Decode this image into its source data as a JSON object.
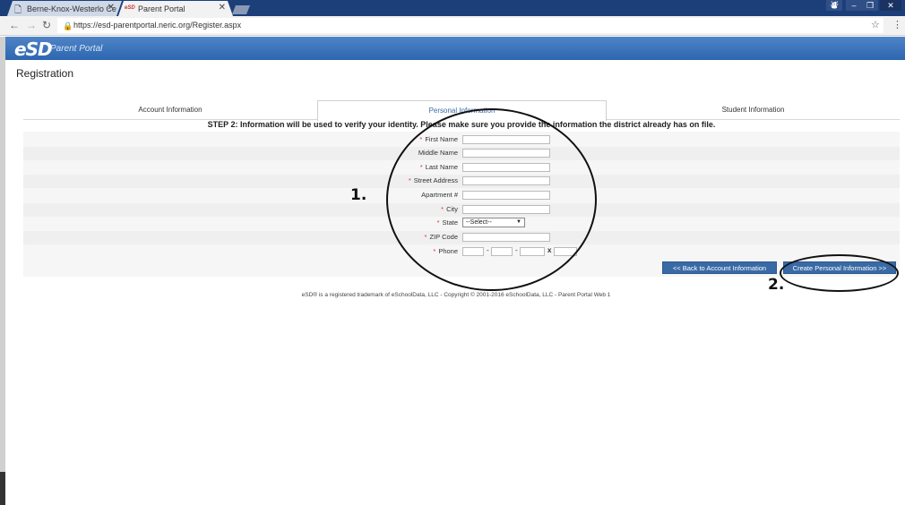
{
  "browser": {
    "tabs": [
      {
        "label": "Berne-Knox-Westerlo Ce",
        "icon": "page-icon"
      },
      {
        "label": "Parent Portal",
        "icon": "esd-favicon",
        "favicon_text": "eSD"
      }
    ],
    "url": "https://esd-parentportal.neric.org/Register.aspx"
  },
  "app": {
    "logo": "eSD",
    "logo_sub": "Parent Portal",
    "accent_color": "#2d66b0"
  },
  "page": {
    "title": "Registration",
    "tabs": [
      "Account Information",
      "Personal Information",
      "Student Information"
    ],
    "active_tab": 1,
    "step_text": "STEP 2: Information will be used to verify your identity. Please make sure you provide the information the district already has on file."
  },
  "form": {
    "fields": [
      {
        "label": "First Name",
        "required": true
      },
      {
        "label": "Middle Name",
        "required": false
      },
      {
        "label": "Last Name",
        "required": true
      },
      {
        "label": "Street Address",
        "required": true
      },
      {
        "label": "Apartment #",
        "required": false
      },
      {
        "label": "City",
        "required": true
      },
      {
        "label": "State",
        "required": true,
        "selected": "--Select--"
      },
      {
        "label": "ZIP Code",
        "required": true
      },
      {
        "label": "Phone",
        "required": true
      }
    ],
    "phone_sep": "-",
    "phone_ext": "x"
  },
  "buttons": {
    "back": "<< Back to Account Information",
    "create": "Create Personal Information >>"
  },
  "footer": "eSD® is a registered trademark of eSchoolData, LLC - Copyright © 2001-2016 eSchoolData, LLC - Parent Portal Web 1",
  "annotations": [
    "1.",
    "2."
  ]
}
